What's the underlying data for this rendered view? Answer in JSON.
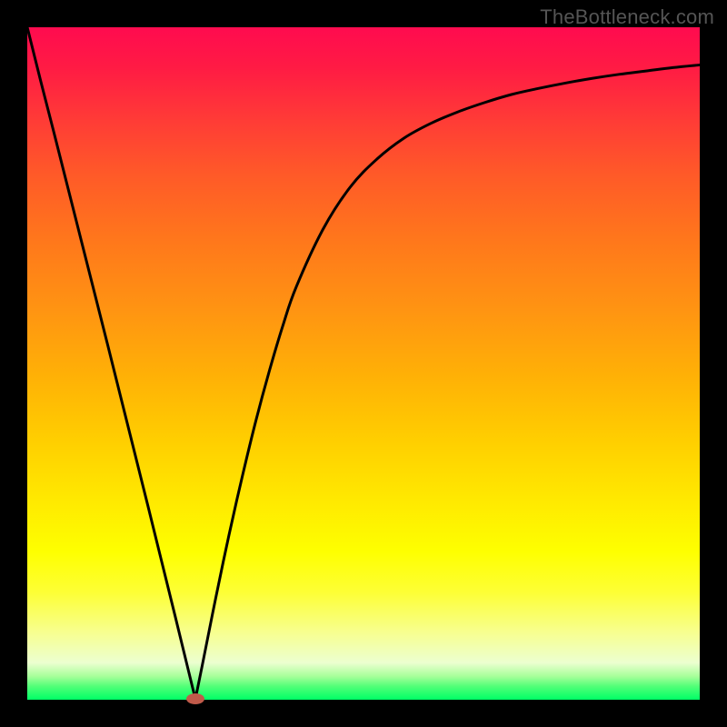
{
  "watermark": "TheBottleneck.com",
  "colors": {
    "background": "#000000",
    "curve": "#000000",
    "marker": "#c05a4a"
  },
  "chart_data": {
    "type": "line",
    "title": "",
    "xlabel": "",
    "ylabel": "",
    "xlim": [
      0,
      100
    ],
    "ylim": [
      0,
      100
    ],
    "grid": false,
    "legend": false,
    "series": [
      {
        "name": "bottleneck-curve",
        "x": [
          0,
          2,
          4,
          6,
          8,
          10,
          12,
          14,
          16,
          18,
          20,
          22,
          24,
          25,
          26,
          28,
          30,
          32,
          34,
          36,
          38,
          40,
          44,
          48,
          52,
          56,
          60,
          64,
          68,
          72,
          76,
          80,
          84,
          88,
          92,
          96,
          100
        ],
        "y": [
          100,
          92,
          84.2,
          76.3,
          68.4,
          60.5,
          52.6,
          44.6,
          36.6,
          28.6,
          20.5,
          12.4,
          4.2,
          0.1,
          5.0,
          15.0,
          24.5,
          33.3,
          41.5,
          48.9,
          55.6,
          61.4,
          70.0,
          76.2,
          80.4,
          83.5,
          85.7,
          87.4,
          88.8,
          90.0,
          90.9,
          91.7,
          92.4,
          93.0,
          93.5,
          94.0,
          94.4
        ]
      }
    ],
    "marker": {
      "x": 25,
      "y": 0.1
    },
    "gradient_stops": [
      {
        "pos": 0,
        "color": "#ff0b4f"
      },
      {
        "pos": 0.32,
        "color": "#ff781b"
      },
      {
        "pos": 0.62,
        "color": "#ffd000"
      },
      {
        "pos": 0.84,
        "color": "#fdff35"
      },
      {
        "pos": 1.0,
        "color": "#00ff66"
      }
    ]
  }
}
